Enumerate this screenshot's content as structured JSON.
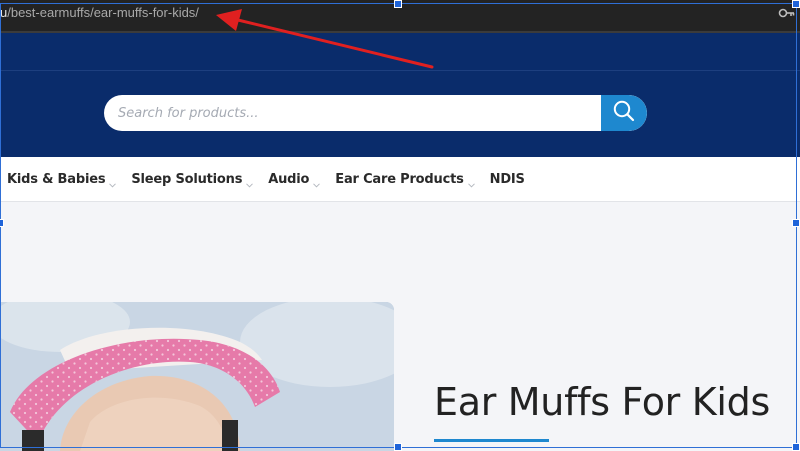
{
  "browser": {
    "url_prefix": "u",
    "url_path": "/best-earmuffs/ear-muffs-for-kids/",
    "extension_icon": "key-icon"
  },
  "search": {
    "placeholder": "Search for products...",
    "button_icon": "search-icon"
  },
  "nav": {
    "items": [
      {
        "label": "Kids & Babies",
        "has_dropdown": true
      },
      {
        "label": "Sleep Solutions",
        "has_dropdown": true
      },
      {
        "label": "Audio",
        "has_dropdown": true
      },
      {
        "label": "Ear Care Products",
        "has_dropdown": true
      },
      {
        "label": "NDIS",
        "has_dropdown": false
      }
    ]
  },
  "hero": {
    "title": "Ear Muffs For Kids"
  },
  "colors": {
    "header_bg": "#0a2c6b",
    "accent": "#1e88cf",
    "annotation_arrow": "#e02020",
    "selection": "#1f64d9"
  }
}
